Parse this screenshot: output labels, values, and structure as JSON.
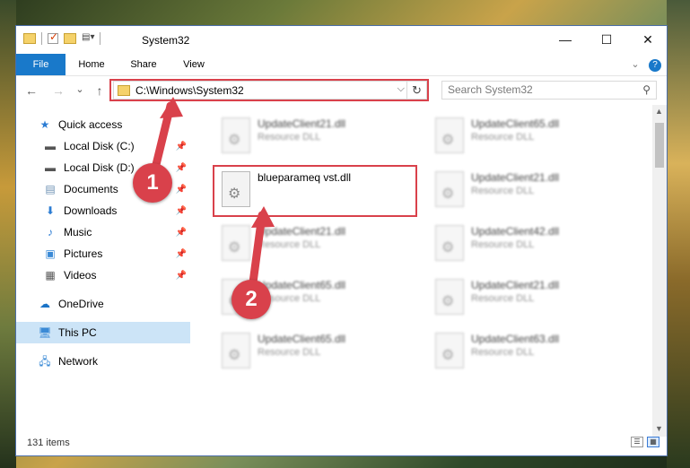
{
  "window": {
    "title": "System32"
  },
  "ribbon": {
    "tabs": [
      "File",
      "Home",
      "Share",
      "View"
    ]
  },
  "titlebar": {
    "minimize": "—",
    "maximize": "☐",
    "close": "✕"
  },
  "address": {
    "path": "C:\\Windows\\System32",
    "dropdown": "⌵",
    "refresh": "↻"
  },
  "search": {
    "placeholder": "Search System32",
    "icon": "⚲"
  },
  "nav": {
    "back": "←",
    "forward": "→",
    "recent": "⌄",
    "up": "↑"
  },
  "sidebar": {
    "items": [
      {
        "label": "Quick access",
        "icon": "star-icon"
      },
      {
        "label": "Local Disk (C:)",
        "icon": "drive-icon"
      },
      {
        "label": "Local Disk (D:)",
        "icon": "drive-icon"
      },
      {
        "label": "Documents",
        "icon": "document-icon"
      },
      {
        "label": "Downloads",
        "icon": "download-icon"
      },
      {
        "label": "Music",
        "icon": "music-icon"
      },
      {
        "label": "Pictures",
        "icon": "picture-icon"
      },
      {
        "label": "Videos",
        "icon": "video-icon"
      },
      {
        "label": "OneDrive",
        "icon": "cloud-icon"
      },
      {
        "label": "This PC",
        "icon": "computer-icon"
      },
      {
        "label": "Network",
        "icon": "network-icon"
      }
    ]
  },
  "files": {
    "highlighted": {
      "name": "blueparameq vst.dll",
      "type": ""
    },
    "left": [
      {
        "name": "UpdateClient21.dll",
        "type": "Resource DLL"
      },
      {
        "name": "UpdateClient21.dll",
        "type": "Resource DLL"
      },
      {
        "name": "UpdateClient65.dll",
        "type": "Resource DLL"
      },
      {
        "name": "UpdateClient65.dll",
        "type": "Resource DLL"
      }
    ],
    "right": [
      {
        "name": "UpdateClient65.dll",
        "type": "Resource DLL"
      },
      {
        "name": "UpdateClient21.dll",
        "type": "Resource DLL"
      },
      {
        "name": "UpdateClient42.dll",
        "type": "Resource DLL"
      },
      {
        "name": "UpdateClient21.dll",
        "type": "Resource DLL"
      },
      {
        "name": "UpdateClient63.dll",
        "type": "Resource DLL"
      }
    ]
  },
  "status": {
    "count": "131 items"
  },
  "callouts": {
    "one": "1",
    "two": "2"
  },
  "colors": {
    "accent": "#1979ca",
    "highlight": "#d9414b",
    "selected": "#cce4f7"
  }
}
